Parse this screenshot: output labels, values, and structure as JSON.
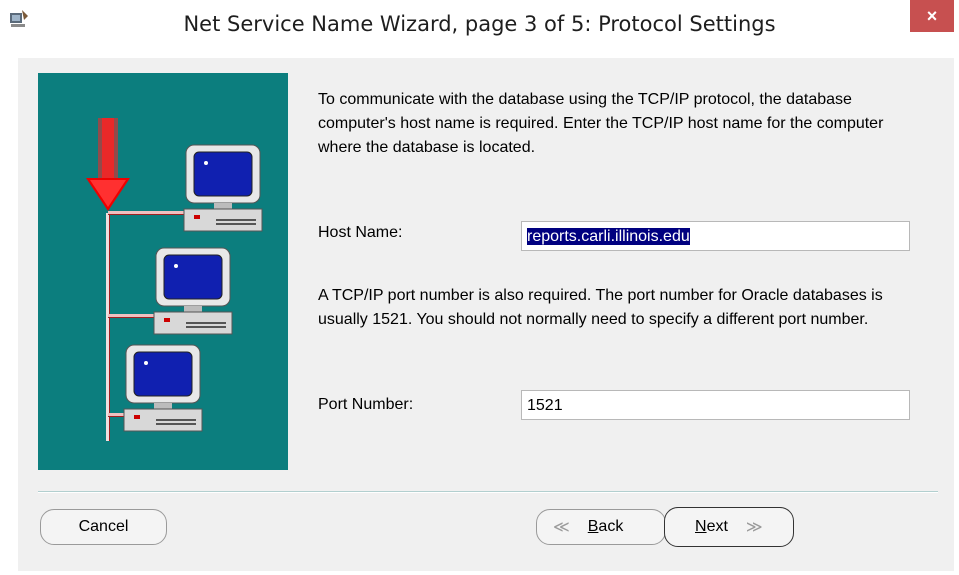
{
  "window": {
    "title": "Net Service Name Wizard, page 3 of 5: Protocol Settings",
    "close_glyph": "×"
  },
  "instructions": {
    "paragraph1": "To communicate with the database using the TCP/IP protocol, the database computer's host name is required.  Enter the TCP/IP host name for the computer where the database is located.",
    "paragraph2": "A TCP/IP port number is also required.  The port number for Oracle databases is usually 1521.  You should not normally need to specify a different port number."
  },
  "form": {
    "host_label": "Host Name:",
    "host_value": "reports.carli.illinois.edu",
    "port_label": "Port Number:",
    "port_value": "1521"
  },
  "buttons": {
    "cancel": "Cancel",
    "back_mnemonic": "B",
    "back_rest": "ack",
    "next_mnemonic": "N",
    "next_rest": "ext"
  },
  "colors": {
    "illustration_bg": "#0c7e7e",
    "close_button": "#c75050",
    "selection": "#000080"
  }
}
